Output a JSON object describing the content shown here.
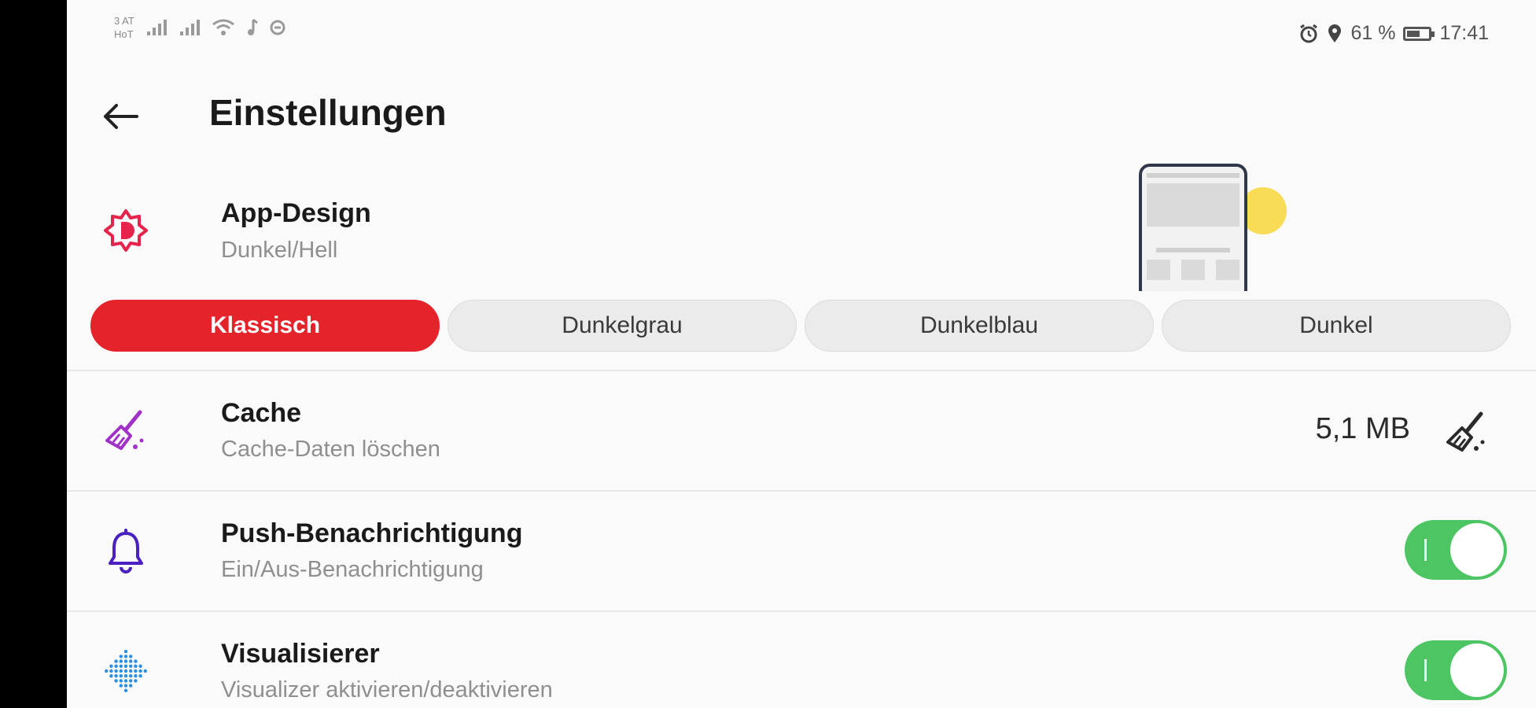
{
  "status_bar": {
    "carrier_line1": "3 AT",
    "carrier_line2": "HoT",
    "battery_percent": "61 %",
    "battery_level": 0.61,
    "time": "17:41",
    "icons_left": [
      "signal-icon",
      "signal-icon",
      "wifi-icon",
      "music-note-icon",
      "vpn-icon"
    ],
    "icons_right": [
      "alarm-icon",
      "location-icon",
      "battery-icon"
    ]
  },
  "header": {
    "title": "Einstellungen",
    "back_icon": "arrow-left-icon"
  },
  "app_design": {
    "title": "App-Design",
    "subtitle": "Dunkel/Hell",
    "icon": "theme-icon",
    "icon_color": "#e5234b",
    "themes": [
      {
        "label": "Klassisch",
        "active": true
      },
      {
        "label": "Dunkelgrau",
        "active": false
      },
      {
        "label": "Dunkelblau",
        "active": false
      },
      {
        "label": "Dunkel",
        "active": false
      }
    ]
  },
  "cache": {
    "title": "Cache",
    "subtitle": "Cache-Daten löschen",
    "size": "5,1 MB",
    "icon": "broom-icon",
    "icon_color": "#a032c8"
  },
  "push": {
    "title": "Push-Benachrichtigung",
    "subtitle": "Ein/Aus-Benachrichtigung",
    "icon": "bell-icon",
    "icon_color": "#4a20c0",
    "enabled": true
  },
  "visualizer": {
    "title": "Visualisierer",
    "subtitle": "Visualizer aktivieren/deaktivieren",
    "icon": "visualizer-icon",
    "icon_color": "#2a8fe0",
    "enabled": true
  },
  "colors": {
    "accent": "#e5232b",
    "toggle_on": "#4cc562"
  }
}
